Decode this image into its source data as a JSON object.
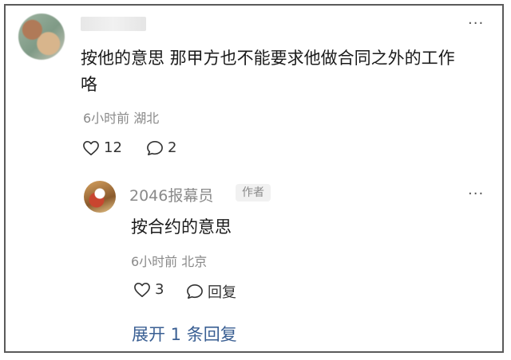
{
  "comment": {
    "content": "按他的意思 那甲方也不能要求他做合同之外的工作咯",
    "time_location": "6小时前 湖北",
    "likes": "12",
    "replies": "2",
    "more_icon": "more-icon"
  },
  "reply": {
    "username": "2046报幕员",
    "badge": "作者",
    "content": "按合约的意思",
    "time_location": "6小时前 北京",
    "likes": "3",
    "reply_label": "回复"
  },
  "expand_label": "展开 1 条回复",
  "colors": {
    "link": "#3a5f93",
    "meta": "#8a8a8a",
    "text": "#1a1a1a"
  }
}
